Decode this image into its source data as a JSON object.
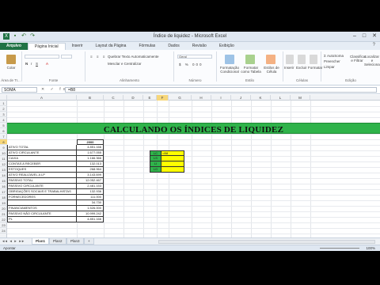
{
  "window": {
    "title": "Índice de liquidez - Microsoft Excel",
    "controls": [
      "–",
      "□",
      "✕"
    ]
  },
  "quick_access": [
    "save",
    "undo",
    "redo"
  ],
  "ribbon_tabs": [
    {
      "label": "Arquivo",
      "kind": "file"
    },
    {
      "label": "Página Inicial",
      "kind": "active"
    },
    {
      "label": "Inserir",
      "kind": ""
    },
    {
      "label": "Layout da Página",
      "kind": ""
    },
    {
      "label": "Fórmulas",
      "kind": ""
    },
    {
      "label": "Dados",
      "kind": ""
    },
    {
      "label": "Revisão",
      "kind": ""
    },
    {
      "label": "Exibição",
      "kind": ""
    }
  ],
  "ribbon_groups": [
    {
      "name": "Área de Tr...",
      "items": [
        "Colar"
      ]
    },
    {
      "name": "Fonte",
      "items": []
    },
    {
      "name": "Alinhamento",
      "items": [
        "Quebrar Texto Automaticamente",
        "Mesclar e Centralizar"
      ]
    },
    {
      "name": "Número",
      "items": [
        "Geral"
      ]
    },
    {
      "name": "Estilo",
      "items": [
        "Formatação Condicional",
        "Formatar como Tabela",
        "Estilos de Célula"
      ]
    },
    {
      "name": "Células",
      "items": [
        "Inserir",
        "Excluir",
        "Formatar"
      ]
    },
    {
      "name": "Edição",
      "items": [
        "AutoSoma",
        "Preencher",
        "Limpar",
        "Classificar e Filtrar",
        "Localizar e Selecionar"
      ]
    }
  ],
  "formula_bar": {
    "name_box": "SOMA",
    "icons": [
      "✕",
      "✓",
      "fx"
    ],
    "formula": "=B8"
  },
  "columns": [
    "A",
    "B",
    "C",
    "D",
    "E",
    "F",
    "G",
    "H",
    "I",
    "J",
    "K",
    "L",
    "M"
  ],
  "selected_column": "F",
  "rows": [
    "1",
    "2",
    "3",
    "4",
    "5",
    "6",
    "7",
    "8",
    "9",
    "10",
    "11",
    "12",
    "13",
    "14",
    "15",
    "16",
    "17",
    "18",
    "19",
    "20",
    "21",
    "22",
    "23",
    "24"
  ],
  "selected_row": "8",
  "banner": "CALCULANDO OS ÍNDICES DE LIQUIDEZ",
  "year_header": "2000",
  "accounts": [
    {
      "label": "ATIVO TOTAL",
      "value": "4.851.166"
    },
    {
      "label": "ATIVO CIRCULANTE",
      "value": "1.677.055"
    },
    {
      "label": "CAIXA",
      "value": "1.166.366"
    },
    {
      "label": "CONTAS A RECEBER",
      "value": "132.013"
    },
    {
      "label": "ESTOQUES",
      "value": "268.964"
    },
    {
      "label": "ATIVO REALIZAVEL A LP",
      "value": "3.143.699"
    },
    {
      "label": "PASSIVO TOTAL",
      "value": "12.052.467"
    },
    {
      "label": "PASSIVO CIRCULANTE",
      "value": "2.481.153"
    },
    {
      "label": "OBRIGAÇÕES SOCIAIS E TRABALHISTAS",
      "value": "132.936"
    },
    {
      "label": "FORNECEDORES",
      "value": "111.000"
    },
    {
      "label": "",
      "value": "34.730"
    },
    {
      "label": "FINANCIAMENTOS",
      "value": "1.526.000"
    },
    {
      "label": "PASSIVO NÃO CIRCULANTE",
      "value": "10.999.242"
    },
    {
      "label": "PL",
      "value": "4.851.166"
    }
  ],
  "ratios": [
    {
      "label": "LC",
      "value": "=B8"
    },
    {
      "label": "LS",
      "value": ""
    },
    {
      "label": "LI",
      "value": ""
    },
    {
      "label": "LG",
      "value": ""
    }
  ],
  "sheets": [
    {
      "label": "Plan1",
      "active": true
    },
    {
      "label": "Plan2",
      "active": false
    },
    {
      "label": "Plan3",
      "active": false
    }
  ],
  "status": {
    "mode": "Apontar",
    "zoom": "100%"
  }
}
